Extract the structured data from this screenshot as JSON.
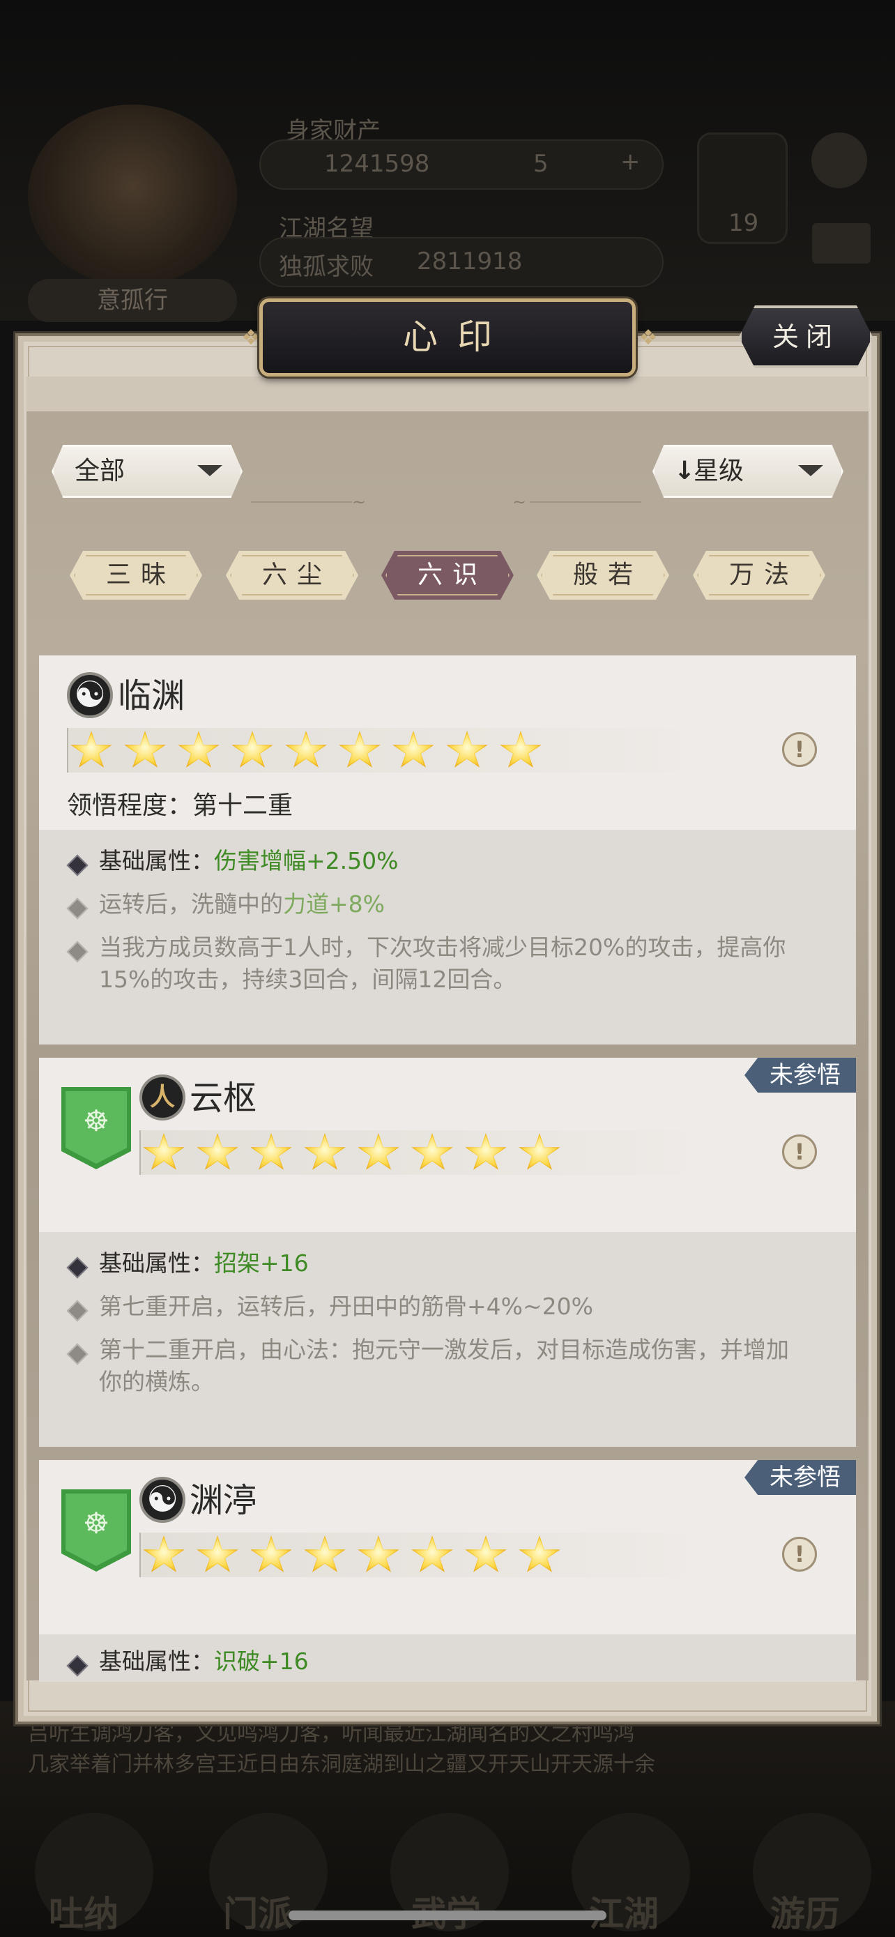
{
  "background": {
    "player_name": "意孤行",
    "wealth_label": "身家财产",
    "gold": "1241598",
    "gems": "5",
    "plus": "+",
    "fame_label": "江湖名望",
    "title": "独孤求败",
    "fame_value": "2811918",
    "level": "19",
    "bottom_text_1": "吕听生调鸿刀客，义见鸣鸿刀客，听闻最近江湖闻名的义之村鸣鸿",
    "bottom_text_2": "几家举着门并林多宫王近日由东洞庭湖到山之疆又开天山开天源十余",
    "nav": [
      "吐纳",
      "门派",
      "武学",
      "江湖",
      "游历"
    ]
  },
  "dialog": {
    "title": "心印",
    "close_label": "关闭",
    "filter": {
      "selected": "全部"
    },
    "sort": {
      "arrow": "↓",
      "selected": "星级"
    },
    "tabs": [
      {
        "label": "三昧",
        "active": false
      },
      {
        "label": "六尘",
        "active": false
      },
      {
        "label": "六识",
        "active": true
      },
      {
        "label": "般若",
        "active": false
      },
      {
        "label": "万法",
        "active": false
      }
    ],
    "cards": [
      {
        "name": "临渊",
        "icon": "taiji-icon",
        "stars": 9,
        "progress": "领悟程度：第十二重",
        "base_label": "基础属性：",
        "base_value": "伤害增幅+2.50%",
        "effect1_prefix": "运转后，洗髓中的",
        "effect1_value": "力道+8%",
        "effect2": "当我方成员数高于1人时，下次攻击将减少目标20%的攻击，提高你15%的攻击，持续3回合，间隔12回合。"
      },
      {
        "name": "云枢",
        "icon": "figure-icon",
        "badge": "未参悟",
        "stars": 8,
        "base_label": "基础属性：",
        "base_value": "招架+16",
        "effect1": "第七重开启，运转后，丹田中的筋骨+4%~20%",
        "effect2": "第十二重开启，由心法：抱元守一激发后，对目标造成伤害，并增加你的横炼。"
      },
      {
        "name": "渊渟",
        "icon": "taiji-icon",
        "badge": "未参悟",
        "stars": 8,
        "base_label": "基础属性：",
        "base_value": "识破+16"
      }
    ]
  }
}
